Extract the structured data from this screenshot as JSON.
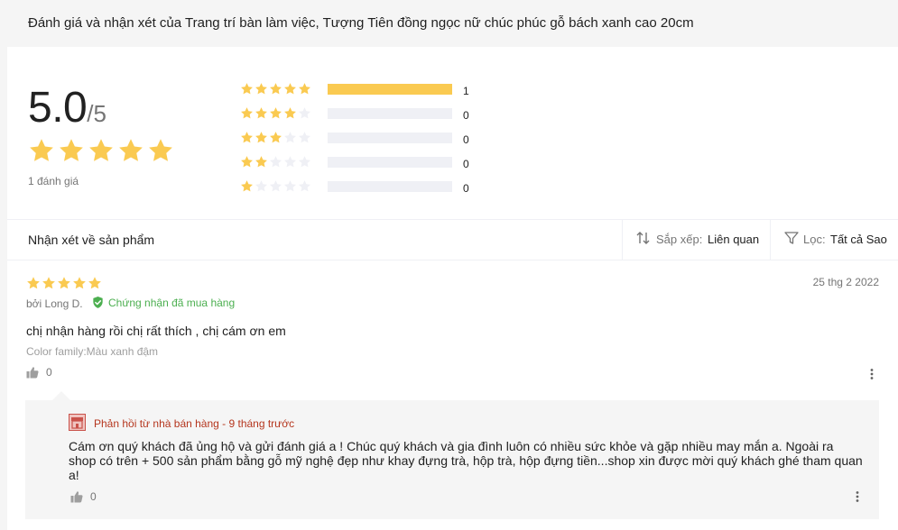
{
  "header": {
    "title": "Đánh giá và nhận xét của Trang trí bàn làm việc, Tượng Tiên đồng ngọc nữ chúc phúc gỗ bách xanh cao 20cm"
  },
  "summary": {
    "average": "5.0",
    "max": "/5",
    "rating_value": 5,
    "count_text": "1 đánh giá",
    "distribution": [
      {
        "stars": 5,
        "count": "1",
        "fraction": 1.0
      },
      {
        "stars": 4,
        "count": "0",
        "fraction": 0
      },
      {
        "stars": 3,
        "count": "0",
        "fraction": 0
      },
      {
        "stars": 2,
        "count": "0",
        "fraction": 0
      },
      {
        "stars": 1,
        "count": "0",
        "fraction": 0
      }
    ]
  },
  "toolbar": {
    "section_title": "Nhận xét về sản phẩm",
    "sort_label": "Sắp xếp:",
    "sort_value": "Liên quan",
    "filter_label": "Lọc:",
    "filter_value": "Tất cả Sao"
  },
  "review": {
    "rating": 5,
    "date": "25 thg 2 2022",
    "author": "bởi Long D.",
    "verified": "Chứng nhận đã mua hàng",
    "content": "chị nhận hàng rồi chị rất thích , chị cám ơn em",
    "sku": "Color family:Màu xanh đậm",
    "likes": "0",
    "seller_reply": {
      "header": "Phản hồi từ nhà bán hàng - 9 tháng trước",
      "content": "Cám ơn quý khách đã ủng hộ và gửi đánh giá a ! Chúc quý khách và gia đình luôn có nhiều sức khỏe và gặp nhiều may mắn a. Ngoài ra shop có trên + 500 sản phẩm bằng gỗ mỹ nghệ đẹp như khay đựng trà, hộp trà, hộp đựng tiền...shop xin được mời quý khách ghé tham quan a!",
      "likes": "0"
    }
  },
  "colors": {
    "star_filled": "#faca51",
    "star_empty": "#eff0f5",
    "verified_green": "#4caf50",
    "seller_red": "#b5361e"
  },
  "icons": {
    "star": "star-icon",
    "verified": "verified-badge-icon",
    "sort": "sort-arrows-icon",
    "filter": "filter-funnel-icon",
    "like": "thumbs-up-icon",
    "more": "more-vertical-icon",
    "seller": "seller-shop-icon"
  }
}
